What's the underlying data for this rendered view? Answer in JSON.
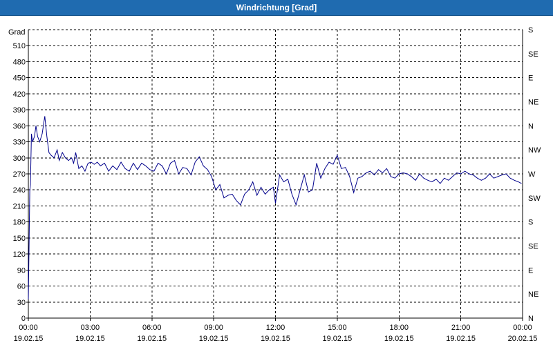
{
  "window": {
    "title": "Windrichtung [Grad]"
  },
  "chart_data": {
    "type": "line",
    "title": "Windrichtung [Grad]",
    "ylabel": "Grad",
    "xlabel": "",
    "ylim": [
      0,
      540
    ],
    "yticks": [
      0,
      30,
      60,
      90,
      120,
      150,
      180,
      210,
      240,
      270,
      300,
      330,
      360,
      390,
      420,
      450,
      480,
      510
    ],
    "right_axis_labels": [
      "N",
      "NE",
      "E",
      "SE",
      "S",
      "SW",
      "W",
      "NW",
      "N",
      "NE",
      "E",
      "SE",
      "S"
    ],
    "right_axis_values": [
      0,
      45,
      90,
      135,
      180,
      225,
      270,
      315,
      360,
      405,
      450,
      495,
      540
    ],
    "x_tick_labels": [
      [
        "00:00",
        "19.02.15"
      ],
      [
        "03:00",
        "19.02.15"
      ],
      [
        "06:00",
        "19.02.15"
      ],
      [
        "09:00",
        "19.02.15"
      ],
      [
        "12:00",
        "19.02.15"
      ],
      [
        "15:00",
        "19.02.15"
      ],
      [
        "18:00",
        "19.02.15"
      ],
      [
        "21:00",
        "19.02.15"
      ],
      [
        "00:00",
        "20.02.15"
      ]
    ],
    "grid": true,
    "line_color": "#00008b",
    "series": [
      {
        "x": [
          0,
          0.03,
          0.07,
          0.1,
          0.15,
          0.2,
          0.3,
          0.37,
          0.45,
          0.55,
          0.67,
          0.8,
          0.9,
          1.0,
          1.1,
          1.25,
          1.4,
          1.5,
          1.65,
          1.8,
          1.95,
          2.1,
          2.2,
          2.3,
          2.45,
          2.6,
          2.75,
          2.9,
          3.05,
          3.2,
          3.35,
          3.5,
          3.7,
          3.9,
          4.1,
          4.3,
          4.5,
          4.7,
          4.9,
          5.1,
          5.3,
          5.5,
          5.7,
          5.9,
          6.1,
          6.3,
          6.5,
          6.7,
          6.9,
          7.1,
          7.3,
          7.5,
          7.7,
          7.9,
          8.1,
          8.3,
          8.5,
          8.7,
          8.9,
          9.1,
          9.3,
          9.5,
          9.7,
          9.9,
          10.1,
          10.3,
          10.5,
          10.7,
          10.9,
          11.1,
          11.3,
          11.5,
          11.7,
          11.9,
          12.0,
          12.2,
          12.4,
          12.6,
          12.8,
          13.0,
          13.2,
          13.4,
          13.6,
          13.8,
          14.0,
          14.2,
          14.4,
          14.6,
          14.8,
          15.0,
          15.2,
          15.4,
          15.6,
          15.8,
          16.0,
          16.2,
          16.4,
          16.6,
          16.8,
          17.0,
          17.2,
          17.4,
          17.6,
          17.8,
          18.0,
          18.2,
          18.4,
          18.6,
          18.8,
          19.0,
          19.2,
          19.4,
          19.6,
          19.8,
          20.0,
          20.2,
          20.4,
          20.6,
          20.8,
          21.0,
          21.2,
          21.4,
          21.6,
          21.8,
          22.0,
          22.2,
          22.4,
          22.6,
          22.8,
          23.0,
          23.2,
          23.4,
          23.6,
          23.8,
          23.95
        ],
        "y": [
          35,
          120,
          240,
          250,
          345,
          330,
          340,
          360,
          340,
          330,
          345,
          378,
          340,
          310,
          305,
          300,
          315,
          295,
          310,
          300,
          295,
          300,
          290,
          310,
          280,
          285,
          275,
          290,
          292,
          288,
          292,
          285,
          290,
          275,
          285,
          278,
          292,
          280,
          275,
          290,
          278,
          290,
          285,
          278,
          275,
          290,
          285,
          270,
          290,
          295,
          270,
          282,
          280,
          268,
          292,
          302,
          285,
          278,
          265,
          240,
          250,
          225,
          230,
          232,
          220,
          212,
          232,
          240,
          255,
          230,
          245,
          232,
          240,
          245,
          215,
          268,
          255,
          260,
          232,
          212,
          240,
          268,
          236,
          240,
          290,
          262,
          280,
          292,
          288,
          305,
          280,
          282,
          265,
          235,
          262,
          265,
          272,
          275,
          268,
          278,
          272,
          280,
          265,
          262,
          270,
          272,
          270,
          265,
          258,
          270,
          262,
          258,
          255,
          260,
          252,
          262,
          258,
          265,
          272,
          270,
          275,
          270,
          268,
          262,
          258,
          262,
          270,
          262,
          265,
          268,
          270,
          262,
          258,
          255,
          252
        ],
        "points_note": ""
      }
    ]
  }
}
